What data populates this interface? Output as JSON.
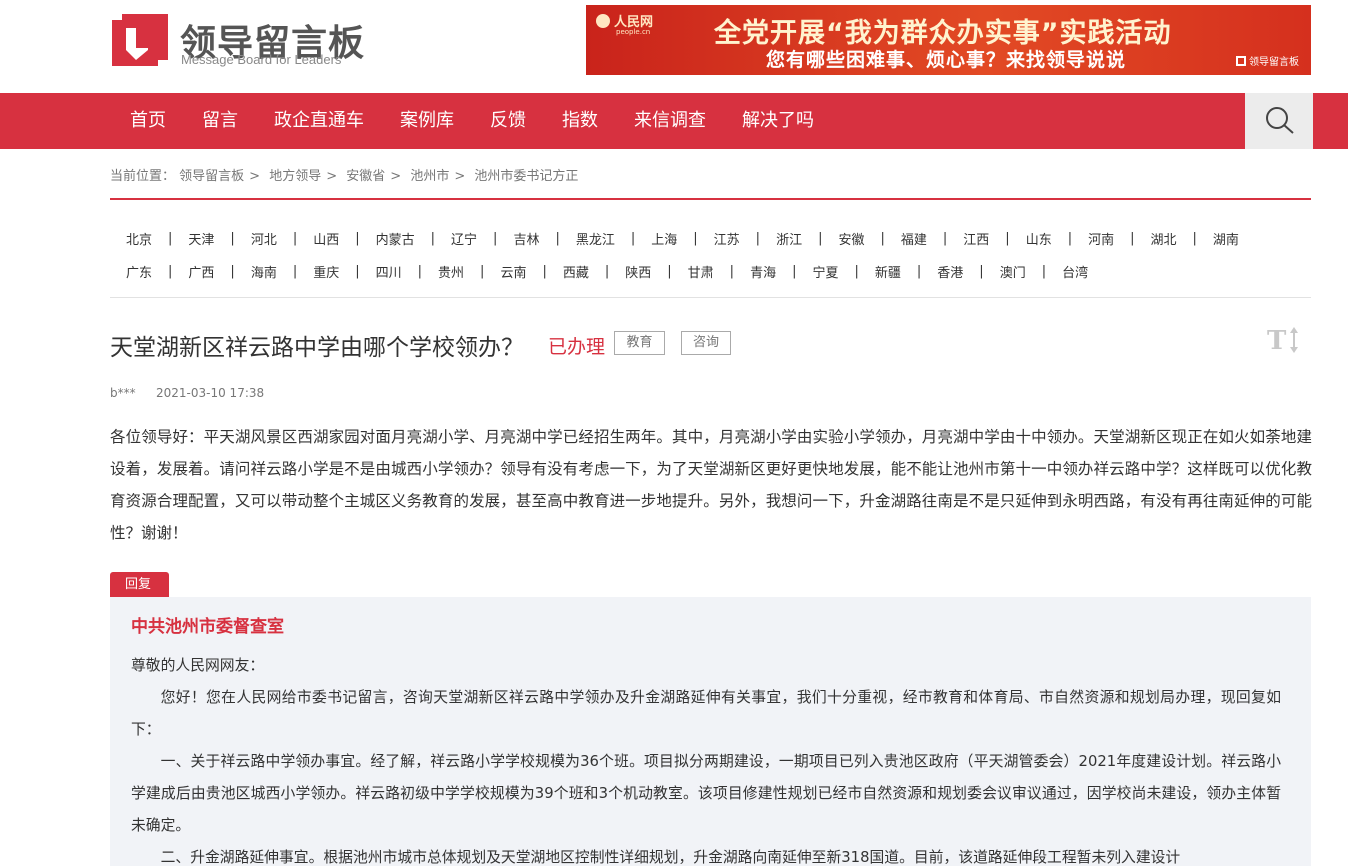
{
  "header": {
    "logo_title": "领导留言板",
    "logo_subtitle": "Message Board for Leaders",
    "banner": {
      "source": "人民网",
      "source_sub": "people.cn",
      "headline": "全党开展“我为群众办实事”实践活动",
      "subline": "您有哪些困难事、烦心事？来找领导说说",
      "corner": "领导留言板"
    }
  },
  "nav": {
    "items": [
      "首页",
      "留言",
      "政企直通车",
      "案例库",
      "反馈",
      "指数",
      "来信调查",
      "解决了吗"
    ],
    "search_icon": "search-icon",
    "color": "#d73140"
  },
  "breadcrumb": {
    "prefix": "当前位置：",
    "items": [
      "领导留言板",
      "地方领导",
      "安徽省",
      "池州市",
      "池州市委书记方正"
    ]
  },
  "regions": {
    "row1": [
      "北京",
      "天津",
      "河北",
      "山西",
      "内蒙古",
      "辽宁",
      "吉林",
      "黑龙江",
      "上海",
      "江苏",
      "浙江",
      "安徽",
      "福建",
      "江西",
      "山东",
      "河南",
      "湖北",
      "湖南"
    ],
    "row2": [
      "广东",
      "广西",
      "海南",
      "重庆",
      "四川",
      "贵州",
      "云南",
      "西藏",
      "陕西",
      "甘肃",
      "青海",
      "宁夏",
      "新疆",
      "香港",
      "澳门",
      "台湾"
    ]
  },
  "post": {
    "title": "天堂湖新区祥云路中学由哪个学校领办？",
    "status": "已办理",
    "tags": [
      "教育",
      "咨询"
    ],
    "font_toggle": "T↕",
    "author": "b***",
    "date": "2021-03-10 17:38",
    "body": "各位领导好：平天湖风景区西湖家园对面月亮湖小学、月亮湖中学已经招生两年。其中，月亮湖小学由实验小学领办，月亮湖中学由十中领办。天堂湖新区现正在如火如荼地建设着，发展着。请问祥云路小学是不是由城西小学领办？领导有没有考虑一下，为了天堂湖新区更好更快地发展，能不能让池州市第十一中领办祥云路中学？这样既可以优化教育资源合理配置，又可以带动整个主城区义务教育的发展，甚至高中教育进一步地提升。另外，我想问一下，升金湖路往南是不是只延伸到永明西路，有没有再往南延伸的可能性？谢谢！"
  },
  "reply": {
    "label": "回复",
    "org": "中共池州市委督查室",
    "greeting": "尊敬的人民网网友：",
    "p1": "您好！您在人民网给市委书记留言，咨询天堂湖新区祥云路中学领办及升金湖路延伸有关事宜，我们十分重视，经市教育和体育局、市自然资源和规划局办理，现回复如下：",
    "p2": "一、关于祥云路中学领办事宜。经了解，祥云路小学学校规模为36个班。项目拟分两期建设，一期项目已列入贵池区政府（平天湖管委会）2021年度建设计划。祥云路小学建成后由贵池区城西小学领办。祥云路初级中学学校规模为39个班和3个机动教室。该项目修建性规划已经市自然资源和规划委会议审议通过，因学校尚未建设，领办主体暂未确定。",
    "p3": "二、升金湖路延伸事宜。根据池州市城市总体规划及天堂湖地区控制性详细规划，升金湖路向南延伸至新318国道。目前，该道路延伸段工程暂未列入建设计"
  }
}
